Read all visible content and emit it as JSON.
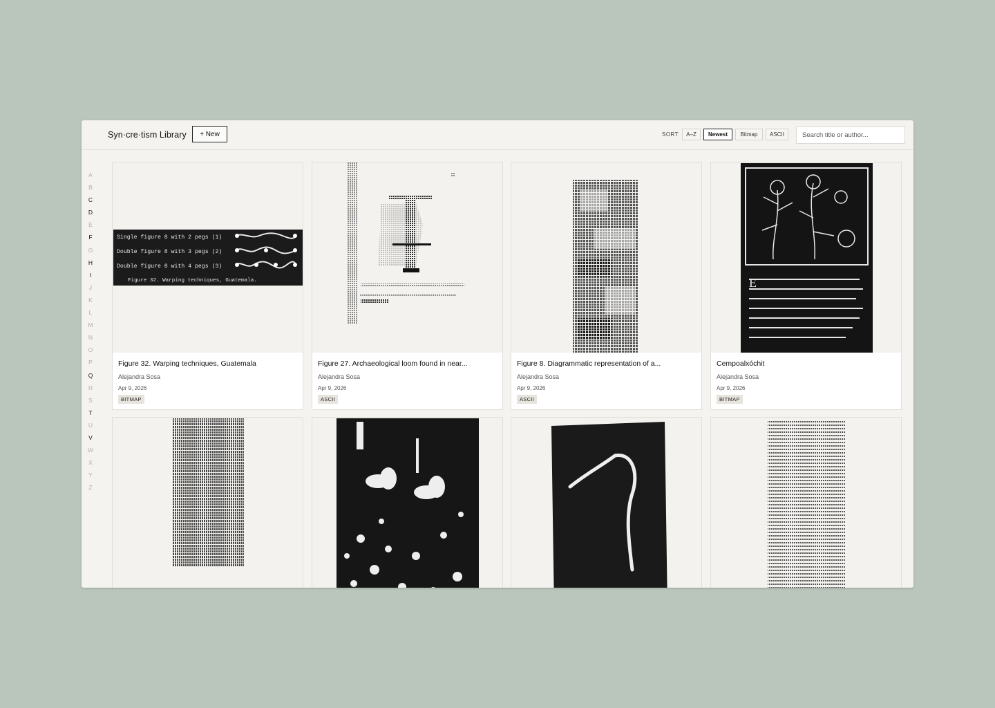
{
  "app": {
    "title": "Syn·cre·tism Library",
    "new_label": "+ New"
  },
  "sort": {
    "label": "SORT",
    "options": [
      "A–Z",
      "Newest",
      "Bitmap",
      "ASCII"
    ],
    "active": "Newest"
  },
  "search": {
    "placeholder": "Search title or author..."
  },
  "alphabet": {
    "letters": [
      "A",
      "B",
      "C",
      "D",
      "E",
      "F",
      "G",
      "H",
      "I",
      "J",
      "K",
      "L",
      "M",
      "N",
      "O",
      "P",
      "Q",
      "R",
      "S",
      "T",
      "U",
      "V",
      "W",
      "X",
      "Y",
      "Z"
    ],
    "active": [
      "C",
      "D",
      "F",
      "H",
      "I",
      "Q",
      "T",
      "V"
    ]
  },
  "cards": [
    {
      "title": "Figure 32. Warping techniques, Guatemala",
      "author": "Alejandra Sosa",
      "date": "Apr 9, 2026",
      "badge": "BITMAP",
      "thumb_text": [
        "Single figure 8 with 2 pegs (1)",
        "Double figure 8 with 3 pegs (2)",
        "Double figure 8 with 4 pegs (3)",
        "Figure 32.  Warping techniques, Guatemala."
      ]
    },
    {
      "title": "Figure 27. Archaeological loom found in near...",
      "author": "Alejandra Sosa",
      "date": "Apr 9, 2026",
      "badge": "ASCII"
    },
    {
      "title": "Figure 8. Diagrammatic representation of a...",
      "author": "Alejandra Sosa",
      "date": "Apr 9, 2026",
      "badge": "ASCII"
    },
    {
      "title": "Cempoalxóchit",
      "author": "Alejandra Sosa",
      "date": "Apr 9, 2026",
      "badge": "BITMAP"
    },
    {
      "title": "",
      "author": "",
      "date": "",
      "badge": ""
    },
    {
      "title": "",
      "author": "",
      "date": "",
      "badge": ""
    },
    {
      "title": "",
      "author": "",
      "date": "",
      "badge": ""
    },
    {
      "title": "",
      "author": "",
      "date": "",
      "badge": ""
    }
  ],
  "colors": {
    "backdrop": "#bac6bc",
    "window": "#f4f3ef",
    "ink": "#1a1a1a"
  }
}
